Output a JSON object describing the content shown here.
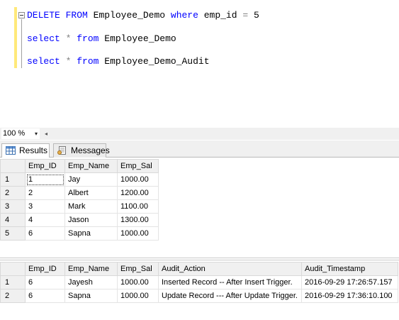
{
  "editor": {
    "line1": {
      "kw1": "DELETE",
      "kw2": "FROM",
      "obj": "Employee_Demo",
      "kw3": "where",
      "col": "emp_id",
      "op": "=",
      "val": "5"
    },
    "line2": {
      "kw1": "select",
      "star": "*",
      "kw2": "from",
      "obj": "Employee_Demo"
    },
    "line3": {
      "kw1": "select",
      "star": "*",
      "kw2": "from",
      "obj": "Employee_Demo_Audit"
    }
  },
  "zoom": {
    "value": "100 %",
    "dropdown_icon": "▾",
    "scroll_icon": "◂"
  },
  "tabs": {
    "results": "Results",
    "messages": "Messages"
  },
  "grid1": {
    "columns": [
      "Emp_ID",
      "Emp_Name",
      "Emp_Sal"
    ],
    "rows": [
      {
        "n": "1",
        "id": "1",
        "name": "Jay",
        "sal": "1000.00"
      },
      {
        "n": "2",
        "id": "2",
        "name": "Albert",
        "sal": "1200.00"
      },
      {
        "n": "3",
        "id": "3",
        "name": "Mark",
        "sal": "1100.00"
      },
      {
        "n": "4",
        "id": "4",
        "name": "Jason",
        "sal": "1300.00"
      },
      {
        "n": "5",
        "id": "6",
        "name": "Sapna",
        "sal": "1000.00"
      }
    ]
  },
  "grid2": {
    "columns": [
      "Emp_ID",
      "Emp_Name",
      "Emp_Sal",
      "Audit_Action",
      "Audit_Timestamp"
    ],
    "rows": [
      {
        "n": "1",
        "id": "6",
        "name": "Jayesh",
        "sal": "1000.00",
        "action": "Inserted Record -- After Insert Trigger.",
        "ts": "2016-09-29 17:26:57.157"
      },
      {
        "n": "2",
        "id": "6",
        "name": "Sapna",
        "sal": "1000.00",
        "action": "Update Record --- After Update Trigger.",
        "ts": "2016-09-29 17:36:10.100"
      }
    ]
  }
}
